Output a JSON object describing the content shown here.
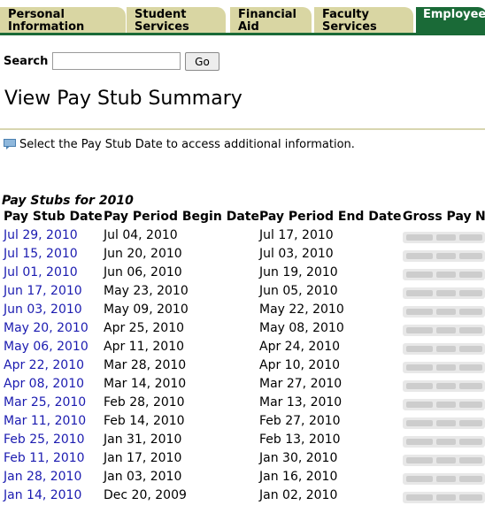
{
  "tabs": [
    {
      "line1": "Personal",
      "line2": "Information"
    },
    {
      "line1": "Student",
      "line2": "Services"
    },
    {
      "line1": "Financial",
      "line2": "Aid"
    },
    {
      "line1": "Faculty",
      "line2": "Services"
    },
    {
      "line1": "Employee",
      "line2": ""
    }
  ],
  "search": {
    "label": "Search",
    "value": "",
    "button": "Go"
  },
  "page_title": "View Pay Stub Summary",
  "info_text": "Select the Pay Stub Date to access additional information.",
  "table": {
    "caption": "Pay Stubs for 2010",
    "headers": [
      "Pay Stub Date",
      "Pay Period Begin Date",
      "Pay Period End Date",
      "Gross Pay",
      "Ne"
    ],
    "rows": [
      {
        "stub": "Jul 29, 2010",
        "begin": "Jul 04, 2010",
        "end": "Jul 17, 2010"
      },
      {
        "stub": "Jul 15, 2010",
        "begin": "Jun 20, 2010",
        "end": "Jul 03, 2010"
      },
      {
        "stub": "Jul 01, 2010",
        "begin": "Jun 06, 2010",
        "end": "Jun 19, 2010"
      },
      {
        "stub": "Jun 17, 2010",
        "begin": "May 23, 2010",
        "end": "Jun 05, 2010"
      },
      {
        "stub": "Jun 03, 2010",
        "begin": "May 09, 2010",
        "end": "May 22, 2010"
      },
      {
        "stub": "May 20, 2010",
        "begin": "Apr 25, 2010",
        "end": "May 08, 2010"
      },
      {
        "stub": "May 06, 2010",
        "begin": "Apr 11, 2010",
        "end": "Apr 24, 2010"
      },
      {
        "stub": "Apr 22, 2010",
        "begin": "Mar 28, 2010",
        "end": "Apr 10, 2010"
      },
      {
        "stub": "Apr 08, 2010",
        "begin": "Mar 14, 2010",
        "end": "Mar 27, 2010"
      },
      {
        "stub": "Mar 25, 2010",
        "begin": "Feb 28, 2010",
        "end": "Mar 13, 2010"
      },
      {
        "stub": "Mar 11, 2010",
        "begin": "Feb 14, 2010",
        "end": "Feb 27, 2010"
      },
      {
        "stub": "Feb 25, 2010",
        "begin": "Jan 31, 2010",
        "end": "Feb 13, 2010"
      },
      {
        "stub": "Feb 11, 2010",
        "begin": "Jan 17, 2010",
        "end": "Jan 30, 2010"
      },
      {
        "stub": "Jan 28, 2010",
        "begin": "Jan 03, 2010",
        "end": "Jan 16, 2010"
      },
      {
        "stub": "Jan 14, 2010",
        "begin": "Dec 20, 2009",
        "end": "Jan 02, 2010"
      }
    ]
  },
  "colors": {
    "tab": "#d9d6a3",
    "tab_active": "#1a6a37",
    "link": "#1b1bb0"
  }
}
